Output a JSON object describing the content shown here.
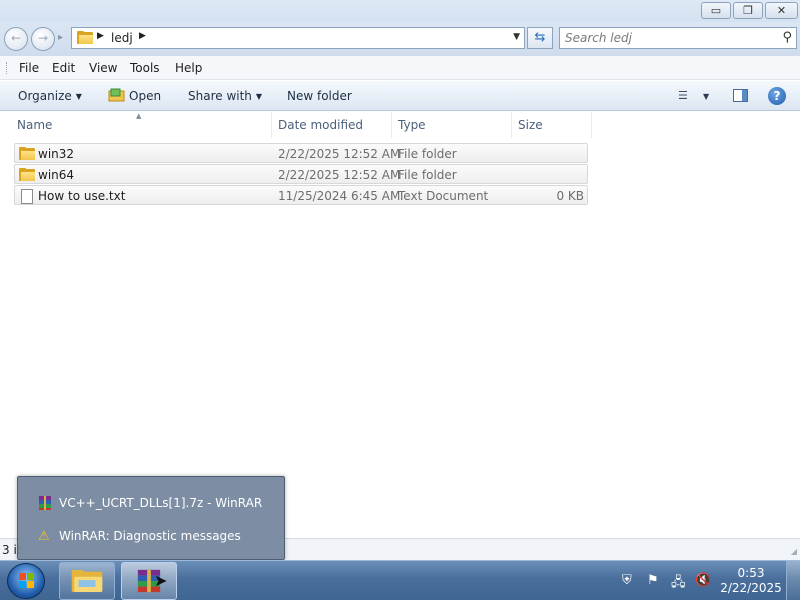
{
  "window": {
    "controls": {
      "minimize": "minimize-icon",
      "maximize": "restore-icon",
      "close": "close-icon"
    }
  },
  "address_bar": {
    "breadcrumb": "ledj",
    "search_placeholder": "Search ledj"
  },
  "menu": [
    "File",
    "Edit",
    "View",
    "Tools",
    "Help"
  ],
  "commands": {
    "organize": "Organize",
    "open": "Open",
    "share_with": "Share with",
    "new_folder": "New folder"
  },
  "columns": {
    "name": "Name",
    "date_modified": "Date modified",
    "type": "Type",
    "size": "Size"
  },
  "files": [
    {
      "name": "win32",
      "date": "2/22/2025 12:52 AM",
      "type": "File folder",
      "size": "",
      "icon": "folder-icon"
    },
    {
      "name": "win64",
      "date": "2/22/2025 12:52 AM",
      "type": "File folder",
      "size": "",
      "icon": "folder-icon"
    },
    {
      "name": "How to use.txt",
      "date": "11/25/2024 6:45 AM",
      "type": "Text Document",
      "size": "0 KB",
      "icon": "text-file-icon"
    }
  ],
  "status": {
    "text": "3 it"
  },
  "popup": {
    "items": [
      {
        "label": "VC++_UCRT_DLLs[1].7z - WinRAR",
        "icon": "winrar-icon"
      },
      {
        "label": "WinRAR: Diagnostic messages",
        "icon": "warning-icon"
      }
    ]
  },
  "taskbar": {
    "clock_time": "0:53",
    "clock_date": "2/22/2025"
  },
  "colors": {
    "folder": "#f2c74a",
    "taskbar": "#4a6f9c",
    "popup_bg": "#76879e",
    "accent": "#2a6bb8"
  }
}
